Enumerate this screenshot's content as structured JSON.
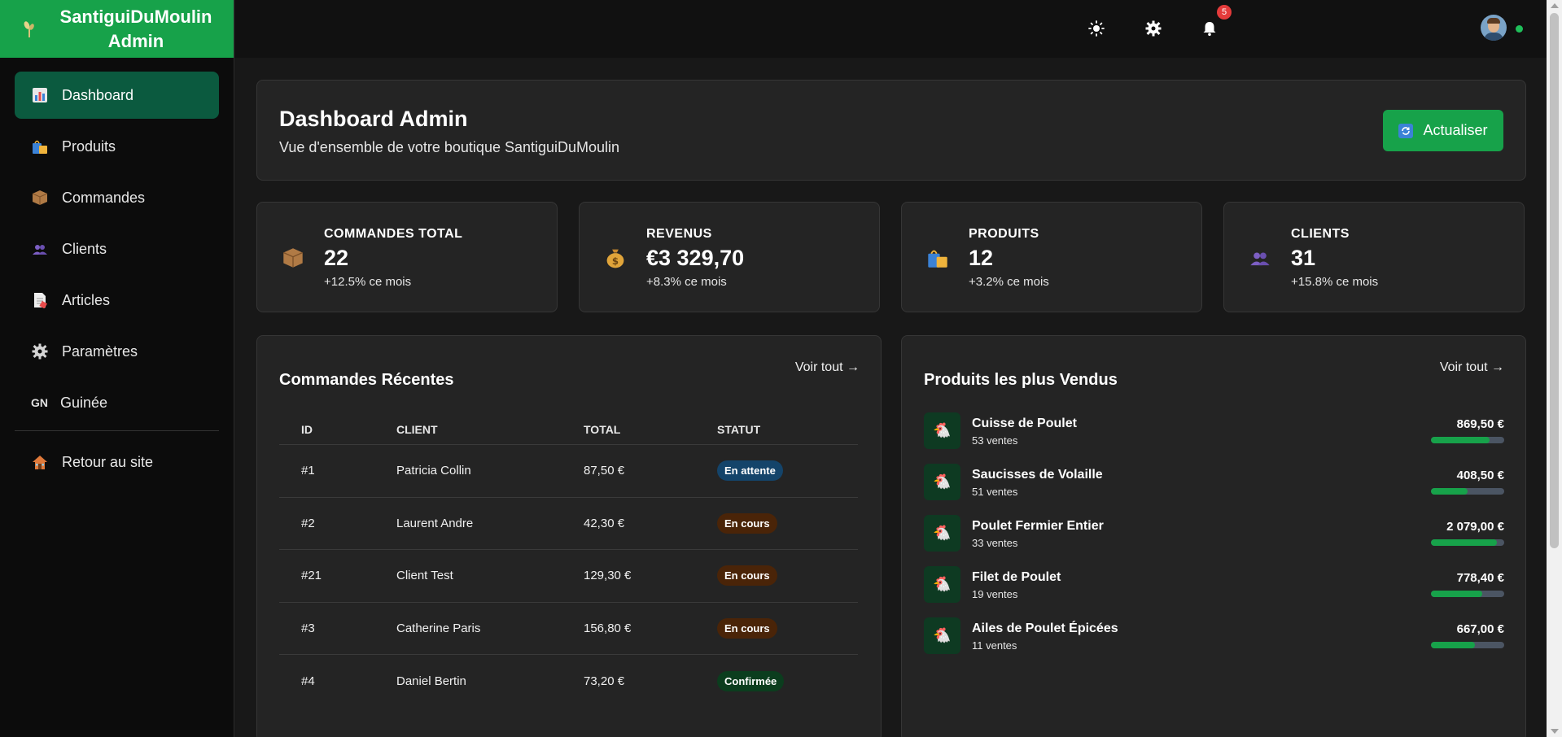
{
  "brand": {
    "line1": "SantiguiDuMoulin",
    "line2": "Admin"
  },
  "sidebar": {
    "items": [
      {
        "label": "Dashboard",
        "icon": "chart-icon"
      },
      {
        "label": "Produits",
        "icon": "shopping-bags-icon"
      },
      {
        "label": "Commandes",
        "icon": "package-icon"
      },
      {
        "label": "Clients",
        "icon": "users-icon"
      },
      {
        "label": "Articles",
        "icon": "document-icon"
      },
      {
        "label": "Paramètres",
        "icon": "gear-icon"
      },
      {
        "label": "Guinée",
        "code": "GN"
      }
    ],
    "back": {
      "label": "Retour au site",
      "icon": "house-icon"
    }
  },
  "topbar": {
    "notifications_count": "5"
  },
  "header": {
    "title": "Dashboard Admin",
    "subtitle": "Vue d'ensemble de votre boutique SantiguiDuMoulin",
    "refresh_label": "Actualiser"
  },
  "stats": [
    {
      "label": "COMMANDES TOTAL",
      "value": "22",
      "change": "+12.5% ce mois",
      "icon": "package-icon"
    },
    {
      "label": "REVENUS",
      "value": "€3 329,70",
      "change": "+8.3% ce mois",
      "icon": "money-bag-icon"
    },
    {
      "label": "PRODUITS",
      "value": "12",
      "change": "+3.2% ce mois",
      "icon": "shopping-bags-icon"
    },
    {
      "label": "CLIENTS",
      "value": "31",
      "change": "+15.8% ce mois",
      "icon": "users-icon"
    }
  ],
  "recent_orders": {
    "title": "Commandes Récentes",
    "see_all": "Voir tout →",
    "columns": [
      "ID",
      "CLIENT",
      "TOTAL",
      "STATUT"
    ],
    "rows": [
      {
        "id": "#1",
        "client": "Patricia Collin",
        "total": "87,50 €",
        "status": "En attente"
      },
      {
        "id": "#2",
        "client": "Laurent Andre",
        "total": "42,30 €",
        "status": "En cours"
      },
      {
        "id": "#21",
        "client": "Client Test",
        "total": "129,30 €",
        "status": "En cours"
      },
      {
        "id": "#3",
        "client": "Catherine Paris",
        "total": "156,80 €",
        "status": "En cours"
      },
      {
        "id": "#4",
        "client": "Daniel Bertin",
        "total": "73,20 €",
        "status": "Confirmée"
      }
    ]
  },
  "top_products": {
    "title": "Produits les plus Vendus",
    "see_all": "Voir tout →",
    "items": [
      {
        "name": "Cuisse de Poulet",
        "sales": "53 ventes",
        "amount": "869,50 €",
        "progress": 0.8
      },
      {
        "name": "Saucisses de Volaille",
        "sales": "51 ventes",
        "amount": "408,50 €",
        "progress": 0.5
      },
      {
        "name": "Poulet Fermier Entier",
        "sales": "33 ventes",
        "amount": "2 079,00 €",
        "progress": 0.9
      },
      {
        "name": "Filet de Poulet",
        "sales": "19 ventes",
        "amount": "778,40 €",
        "progress": 0.7
      },
      {
        "name": "Ailes de Poulet Épicées",
        "sales": "11 ventes",
        "amount": "667,00 €",
        "progress": 0.6
      }
    ]
  },
  "colors": {
    "accent": "#17a24a",
    "active_nav": "#0b5a3f",
    "badge": "#e43b3b"
  }
}
